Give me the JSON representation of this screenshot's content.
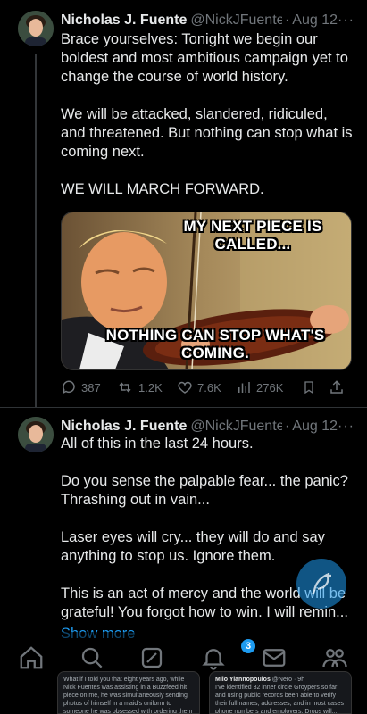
{
  "tweets": [
    {
      "name": "Nicholas J. Fuente",
      "handle": "@NickJFuente",
      "dot": "·",
      "date": "Aug 12",
      "more": "···",
      "paragraphs": [
        "Brace yourselves: Tonight we begin our boldest and most ambitious campaign yet to change the course of world history.",
        "We will be attacked, slandered, ridiculed, and threatened. But nothing can stop what is coming next.",
        "WE WILL MARCH FORWARD."
      ],
      "image": {
        "top_text": "MY NEXT PIECE IS CALLED...",
        "bottom_text": "NOTHING CAN STOP WHAT'S COMING."
      },
      "stats": {
        "replies": "387",
        "reposts": "1.2K",
        "likes": "7.6K",
        "views": "276K"
      }
    },
    {
      "name": "Nicholas J. Fuente",
      "handle": "@NickJFuente",
      "dot": "·",
      "date": "Aug 12",
      "more": "···",
      "paragraphs": [
        "All of this in the last 24 hours.",
        "Do you sense the palpable fear... the panic? Thrashing out in vain...",
        "Laser eyes will cry... they will do and say anything to stop us. Ignore them.",
        "This is an act of mercy and the world will be grateful! You forgot how to win. I will remin..."
      ],
      "show_more": "Show more"
    }
  ],
  "tabbar": {
    "notifications_badge": "3"
  },
  "previews": {
    "left_text": "What if I told you that eight years ago, while Nick Fuentes was assisting in a Buzzfeed hit piece on me, he was simultaneously sending photos of himself in a maid's uniform to someone he was obsessed with ordering them to...",
    "right_name": "Milo Yiannopoulos",
    "right_handle": "@Nero · 9h",
    "right_text": "I've identified 32 inner circle Groypers so far and using public records been able to verify their full names, addresses, and in most cases phone numbers and employers. Drops will..."
  },
  "colors": {
    "background": "#000000",
    "text": "#e7e9ea",
    "muted": "#71767b",
    "accent": "#1d9bf0"
  }
}
